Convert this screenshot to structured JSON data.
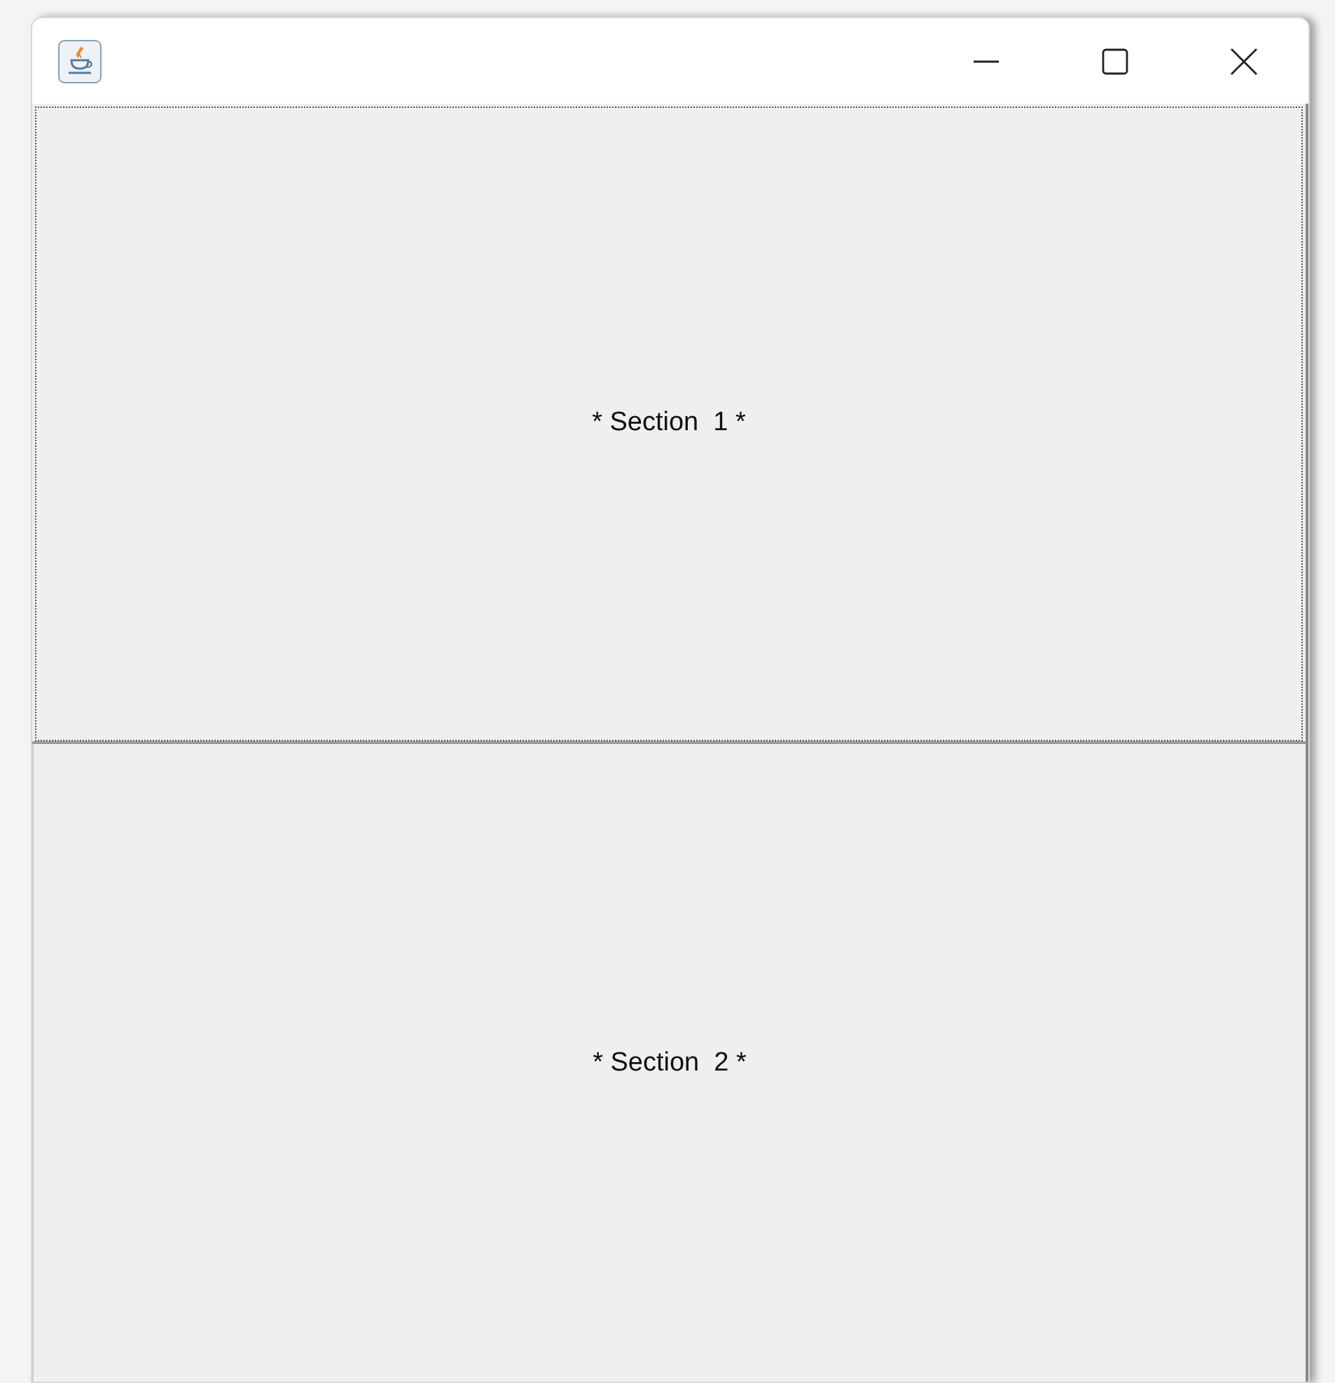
{
  "sections": [
    {
      "label": "* Section  1 *",
      "focused": true
    },
    {
      "label": "* Section  2 *",
      "focused": false
    }
  ]
}
